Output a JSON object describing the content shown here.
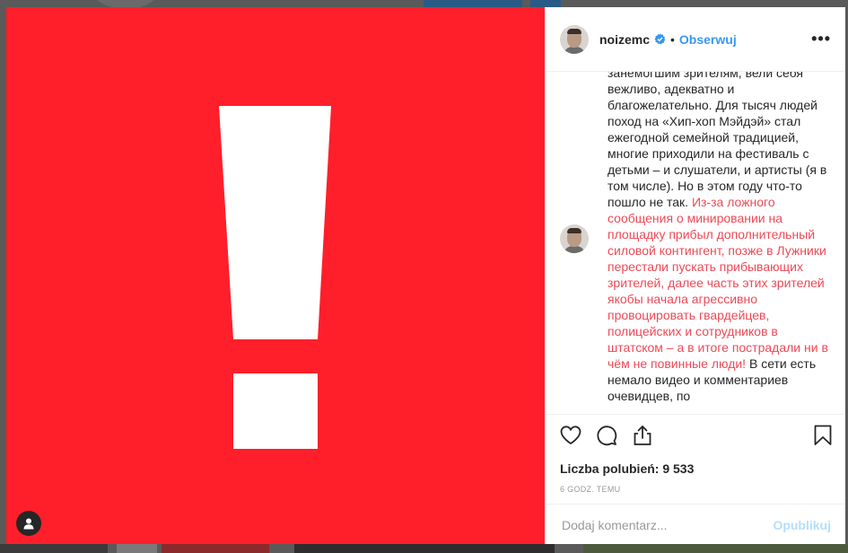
{
  "post": {
    "username": "noizemc",
    "dot": "•",
    "follow_label": "Obserwuj",
    "more_label": "•••",
    "caption_before": "занемогшим зрителям, вели себя вежливо, адекватно и благожелательно. Для тысяч людей поход на «Хип-хоп Мэйдэй» стал ежегодной семейной традицией, многие приходили на фестиваль с детьми – и слушатели, и артисты (я в том числе). Но в этом году что-то пошло не так. ",
    "caption_highlight": "Из-за ложного сообщения о минировании на площадку прибыл дополнительный силовой контингент, позже в Лужники перестали пускать прибывающих зрителей, далее часть этих зрителей якобы начала агрессивно провоцировать гвардейцев, полицейских и сотрудников в штатском – а в итоге пострадали ни в чём не повинные люди!",
    "caption_after": " В сети есть немало видео и комментариев очевидцев, по",
    "likes": "Liczba polubień: 9 533",
    "time": "6 GODZ. TEMU",
    "comment_placeholder": "Dodaj komentarz...",
    "publish_label": "Opublikuj"
  },
  "icons": {
    "like": "heart-icon",
    "comment": "comment-icon",
    "share": "share-icon",
    "save": "bookmark-icon",
    "user_tag": "user-icon",
    "verified": "verified-badge-icon"
  },
  "colors": {
    "media_background": "#ff1f2b",
    "link": "#3897f0",
    "highlight_text": "#ed4956"
  }
}
